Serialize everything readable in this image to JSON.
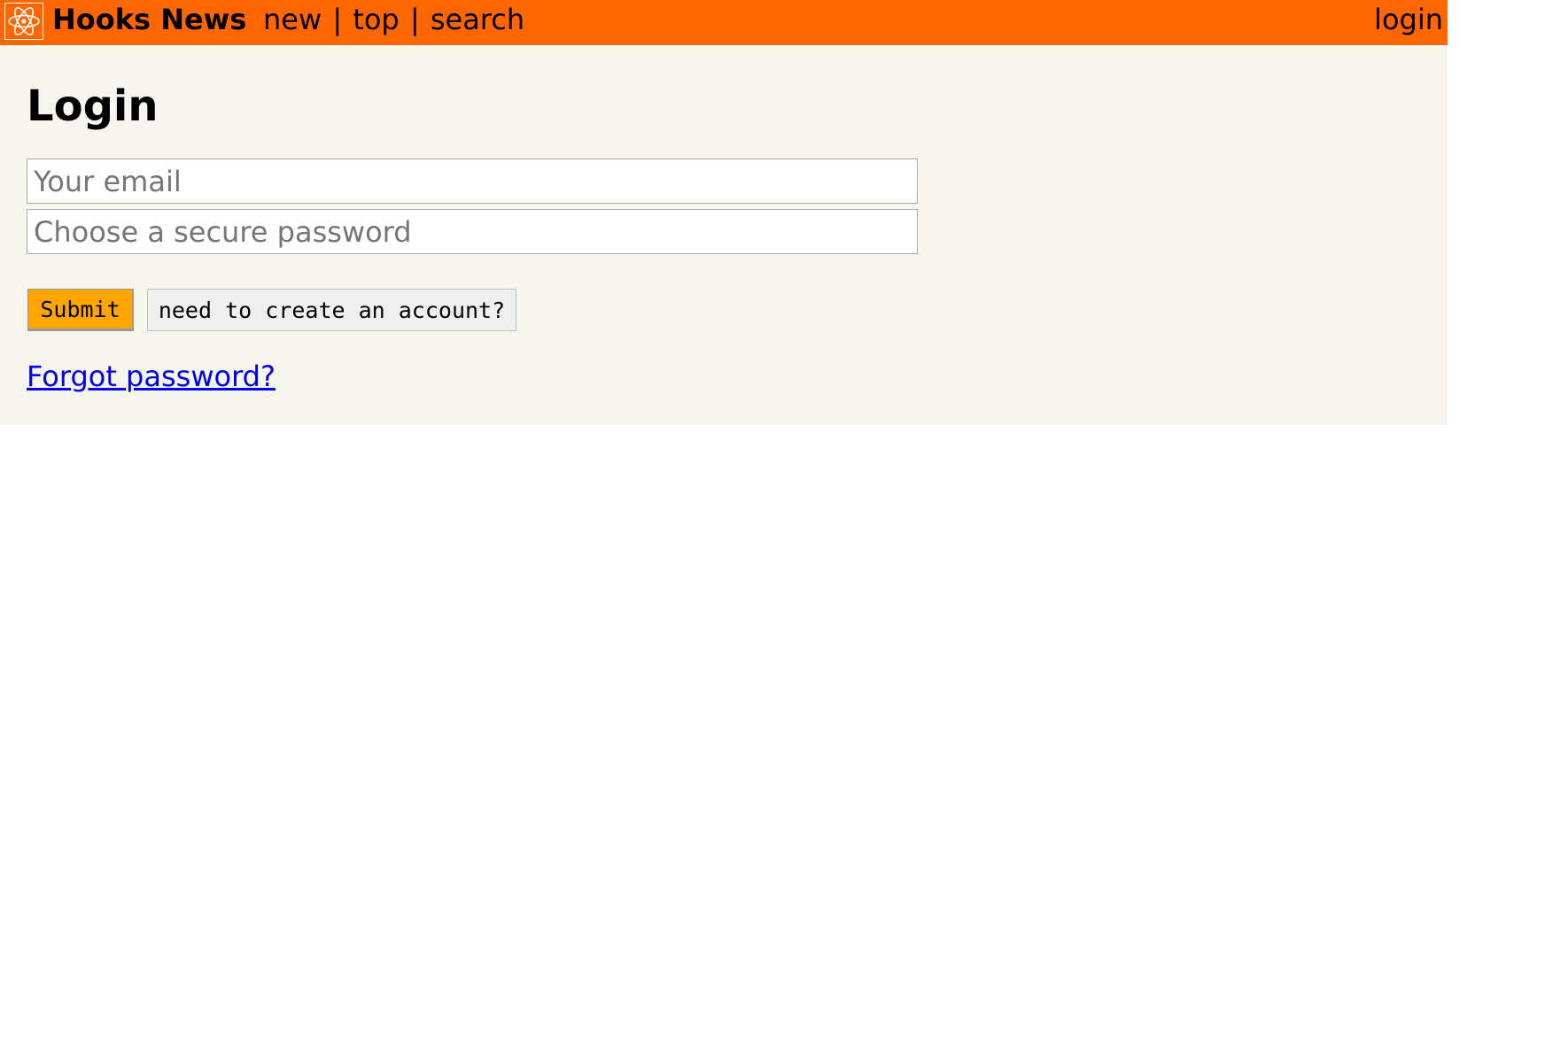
{
  "header": {
    "logo_icon": "react-atom-icon",
    "site_title": "Hooks News",
    "nav": {
      "new": "new",
      "top": "top",
      "search": "search",
      "separator": "|"
    },
    "login": "login"
  },
  "main": {
    "title": "Login",
    "email": {
      "value": "",
      "placeholder": "Your email"
    },
    "password": {
      "value": "",
      "placeholder": "Choose a secure password"
    },
    "submit_label": "Submit",
    "create_account_label": "need to create an account?",
    "forgot_password": "Forgot password?"
  },
  "colors": {
    "header_bg": "#ff6600",
    "page_bg": "#f6f6ef",
    "submit_bg": "#ffa500",
    "link": "#0000ee"
  }
}
